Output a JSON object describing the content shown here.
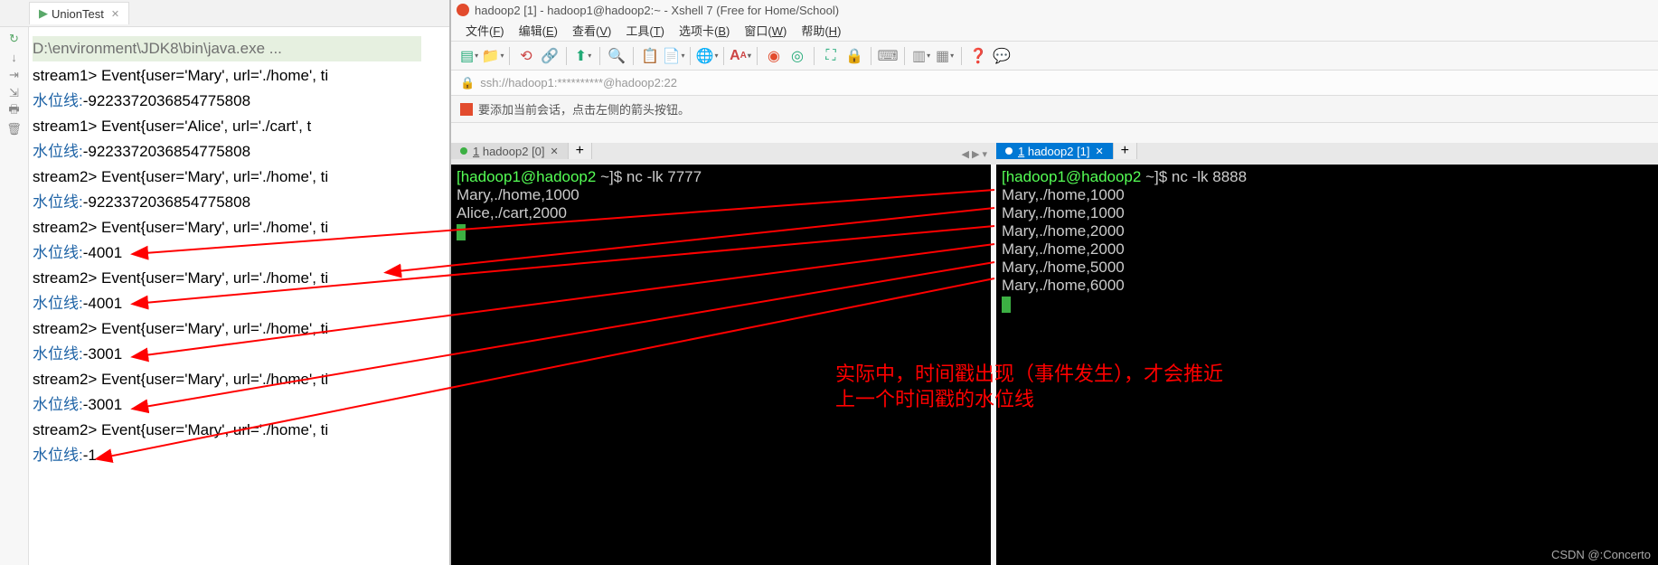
{
  "ide": {
    "tab_name": "UnionTest",
    "cmd": "D:\\environment\\JDK8\\bin\\java.exe ...",
    "lines": [
      {
        "t": "ev",
        "text": "stream1> Event{user='Mary', url='./home', ti"
      },
      {
        "t": "wl",
        "label": "水位线:",
        "val": "-9223372036854775808"
      },
      {
        "t": "ev",
        "text": "stream1> Event{user='Alice', url='./cart', t"
      },
      {
        "t": "wl",
        "label": "水位线:",
        "val": "-9223372036854775808"
      },
      {
        "t": "ev",
        "text": "stream2> Event{user='Mary', url='./home', ti"
      },
      {
        "t": "wl",
        "label": "水位线:",
        "val": "-9223372036854775808"
      },
      {
        "t": "ev",
        "text": "stream2> Event{user='Mary', url='./home', ti"
      },
      {
        "t": "wl",
        "label": "水位线:",
        "val": "-4001"
      },
      {
        "t": "ev",
        "text": "stream2> Event{user='Mary', url='./home', ti"
      },
      {
        "t": "wl",
        "label": "水位线:",
        "val": "-4001"
      },
      {
        "t": "ev",
        "text": "stream2> Event{user='Mary', url='./home', ti"
      },
      {
        "t": "wl",
        "label": "水位线:",
        "val": "-3001"
      },
      {
        "t": "ev",
        "text": "stream2> Event{user='Mary', url='./home', ti"
      },
      {
        "t": "wl",
        "label": "水位线:",
        "val": "-3001"
      },
      {
        "t": "ev",
        "text": "stream2> Event{user='Mary', url='./home', ti"
      },
      {
        "t": "wl",
        "label": "水位线:",
        "val": "-1"
      }
    ]
  },
  "xshell": {
    "title": "hadoop2 [1] - hadoop1@hadoop2:~ - Xshell 7 (Free for Home/School)",
    "menus": [
      "文件(F)",
      "编辑(E)",
      "查看(V)",
      "工具(T)",
      "选项卡(B)",
      "窗口(W)",
      "帮助(H)"
    ],
    "address": "ssh://hadoop1:**********@hadoop2:22",
    "info": "要添加当前会话，点击左侧的箭头按钮。",
    "tab_left": "1 hadoop2 [0]",
    "tab_right": "1 hadoop2 [1]",
    "term_left": {
      "prompt_user": "[hadoop1@hadoop2",
      "prompt_path": " ~]$ ",
      "cmd": "nc -lk 7777",
      "lines": [
        "Mary,./home,1000",
        "Alice,./cart,2000"
      ]
    },
    "term_right": {
      "prompt_user": "[hadoop1@hadoop2",
      "prompt_path": " ~]$ ",
      "cmd": "nc -lk 8888",
      "lines": [
        "Mary,./home,1000",
        "Mary,./home,1000",
        "Mary,./home,2000",
        "Mary,./home,2000",
        "Mary,./home,5000",
        "Mary,./home,6000"
      ]
    }
  },
  "annotation": {
    "line1": "实际中，时间戳出现（事件发生），才会推近",
    "line2": "上一个时间戳的水位线"
  },
  "watermark": "CSDN @:Concerto"
}
